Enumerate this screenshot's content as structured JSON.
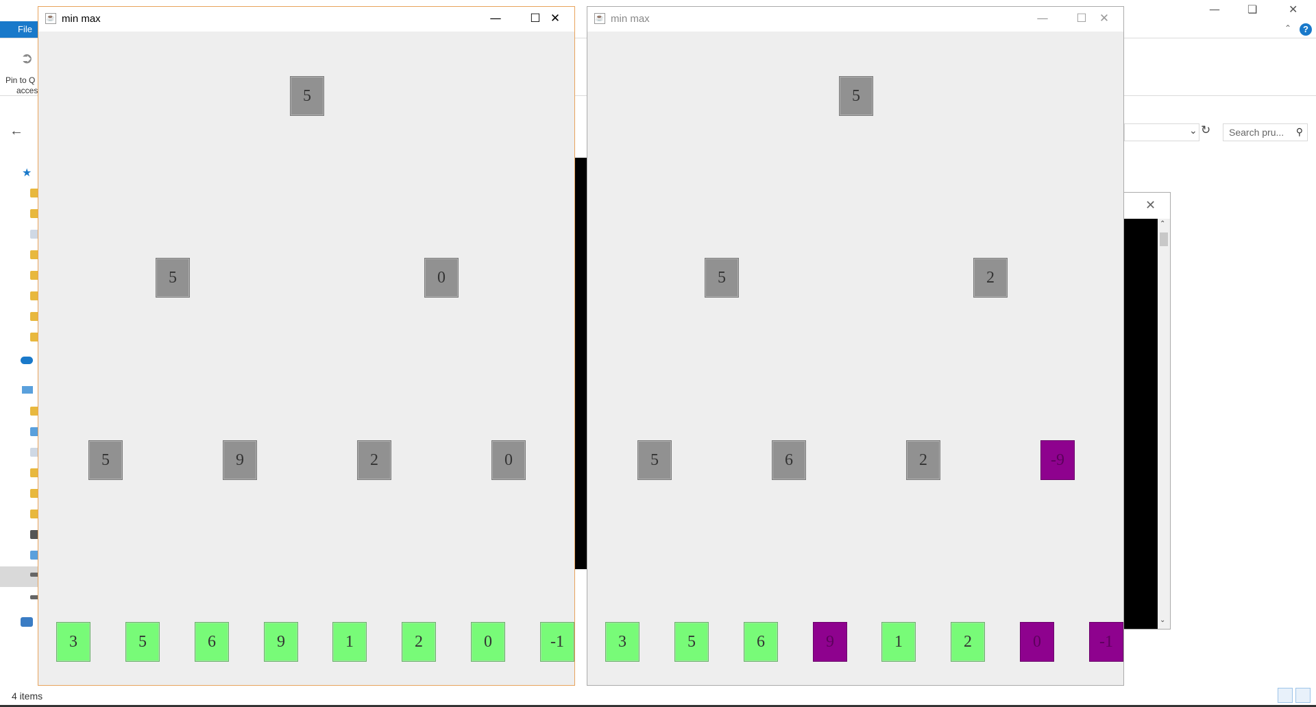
{
  "explorer": {
    "file_tab": "File",
    "pin_label_line1": "Pin to Q",
    "pin_label_line2": "acces",
    "search_placeholder": "Search pru...",
    "status_text": "4 items",
    "accent_color": "#1979ca"
  },
  "window_left": {
    "title": "min max",
    "state": "active",
    "tree": {
      "root": [
        "5"
      ],
      "level1": [
        "5",
        "0"
      ],
      "level2": [
        "5",
        "9",
        "2",
        "0"
      ],
      "leaves": [
        "3",
        "5",
        "6",
        "9",
        "1",
        "2",
        "0",
        "-1"
      ]
    },
    "leaf_colors": [
      "green",
      "green",
      "green",
      "green",
      "green",
      "green",
      "green",
      "green"
    ],
    "level2_colors": [
      "gray",
      "gray",
      "gray",
      "gray"
    ]
  },
  "window_right": {
    "title": "min max",
    "state": "inactive",
    "tree": {
      "root": [
        "5"
      ],
      "level1": [
        "5",
        "2"
      ],
      "level2": [
        "5",
        "6",
        "2",
        "-9"
      ],
      "leaves": [
        "3",
        "5",
        "6",
        "9",
        "1",
        "2",
        "0",
        "-1"
      ]
    },
    "leaf_colors": [
      "green",
      "green",
      "green",
      "purple",
      "green",
      "green",
      "purple",
      "purple"
    ],
    "level2_colors": [
      "gray",
      "gray",
      "gray",
      "purple"
    ]
  },
  "colors": {
    "gray_node": "#919191",
    "green_leaf": "#78fb78",
    "pruned": "#8e028e",
    "window_bg": "#eeeeee"
  },
  "icons": {
    "minimize": "minimize-icon",
    "maximize": "maximize-icon",
    "close": "close-icon",
    "java": "java-icon"
  }
}
